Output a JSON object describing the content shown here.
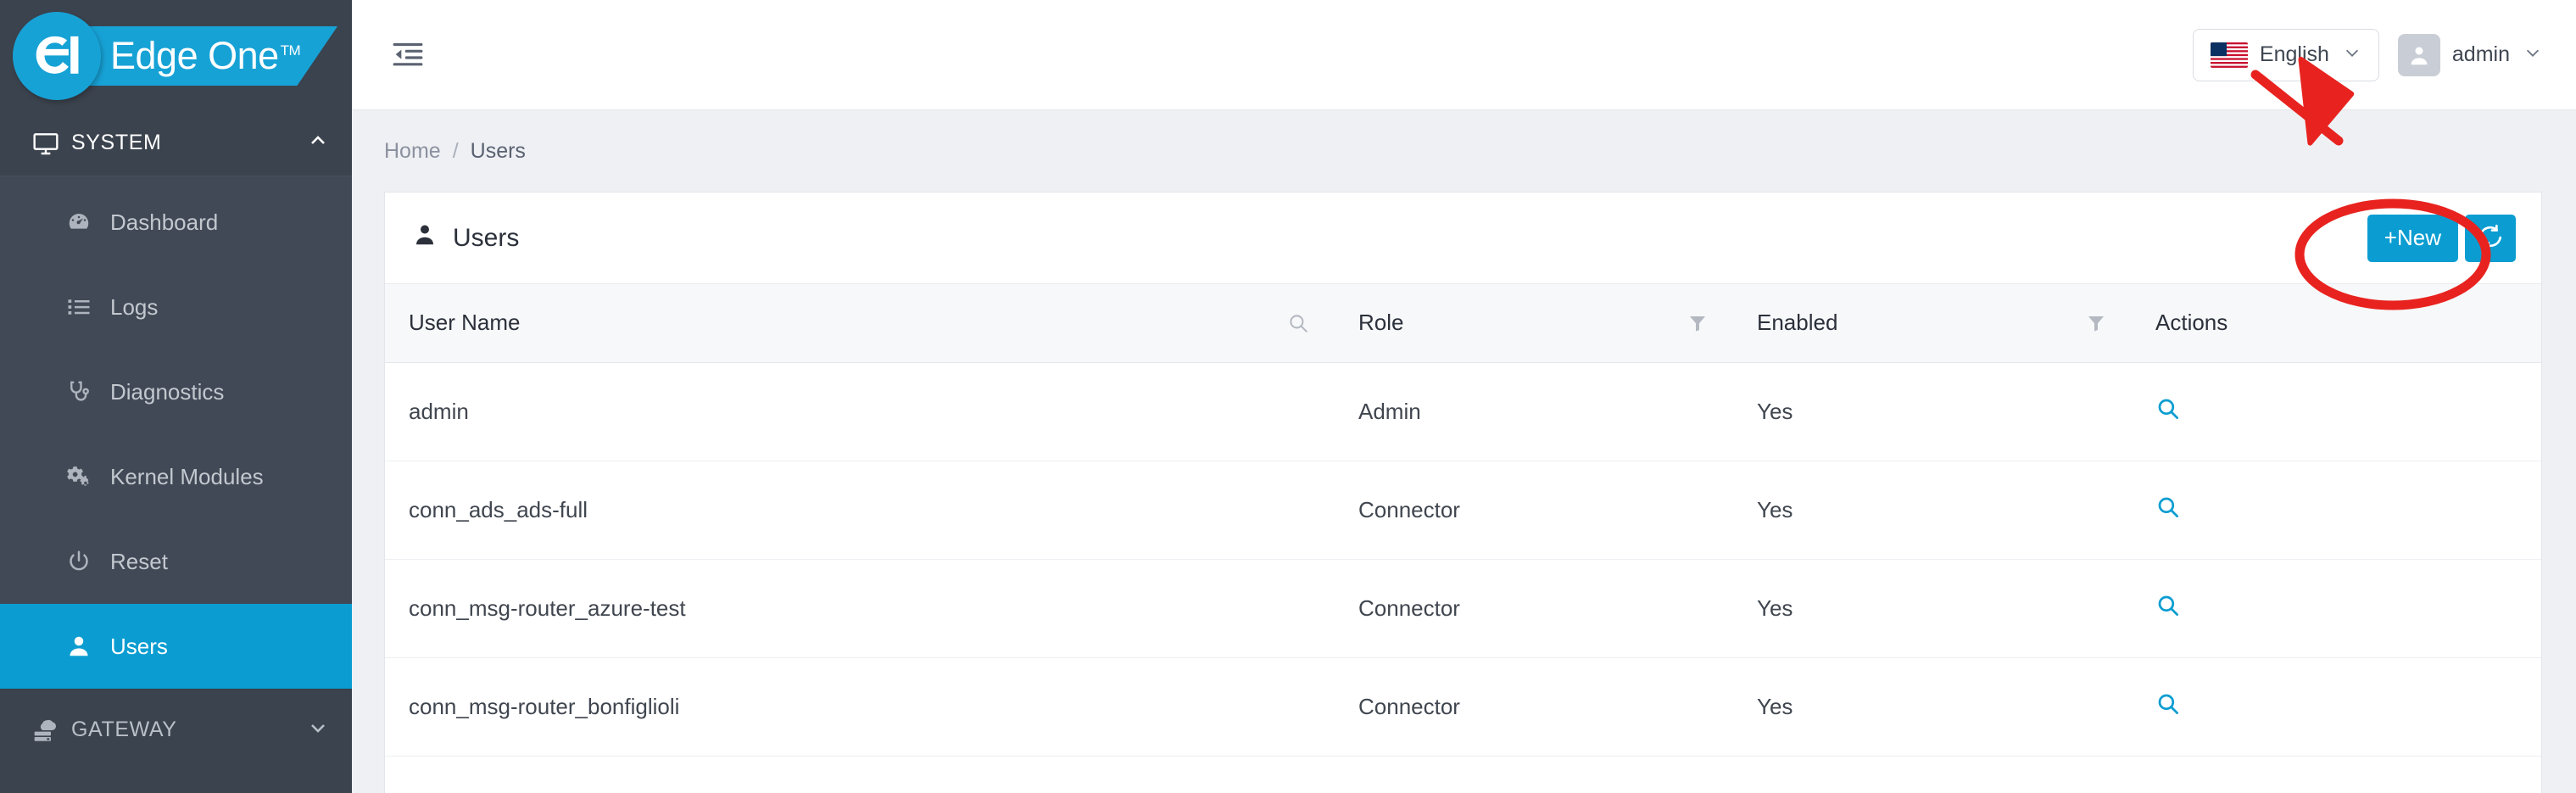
{
  "brand": {
    "name": "Edge One",
    "tm": "TM",
    "logo_icon": "edge-one-logo-icon"
  },
  "sidebar": {
    "groups": [
      {
        "label": "SYSTEM",
        "icon": "monitor-icon",
        "chevron": "chevron-up-icon",
        "expanded": true,
        "items": [
          {
            "label": "Dashboard",
            "icon": "dashboard-gauge-icon",
            "active": false
          },
          {
            "label": "Logs",
            "icon": "list-icon",
            "active": false
          },
          {
            "label": "Diagnostics",
            "icon": "stethoscope-icon",
            "active": false
          },
          {
            "label": "Kernel Modules",
            "icon": "gears-icon",
            "active": false
          },
          {
            "label": "Reset",
            "icon": "power-icon",
            "active": false
          },
          {
            "label": "Users",
            "icon": "user-icon",
            "active": true
          }
        ]
      },
      {
        "label": "GATEWAY",
        "icon": "server-cloud-icon",
        "chevron": "chevron-down-icon",
        "expanded": false,
        "items": []
      }
    ]
  },
  "topbar": {
    "collapse_icon": "collapse-sidebar-icon",
    "language": {
      "label": "English",
      "flag": "us-flag-icon",
      "chevron": "chevron-down-icon"
    },
    "user": {
      "label": "admin",
      "avatar_icon": "user-avatar-icon",
      "chevron": "chevron-down-icon"
    }
  },
  "breadcrumb": {
    "home": "Home",
    "separator": "/",
    "current": "Users"
  },
  "panel": {
    "title": "Users",
    "title_icon": "user-icon",
    "new_button": "+New",
    "refresh_icon": "refresh-icon"
  },
  "table": {
    "columns": [
      {
        "label": "User Name",
        "tool_icon": "search-icon"
      },
      {
        "label": "Role",
        "tool_icon": "filter-icon"
      },
      {
        "label": "Enabled",
        "tool_icon": "filter-icon"
      },
      {
        "label": "Actions",
        "tool_icon": ""
      }
    ],
    "rows": [
      {
        "user_name": "admin",
        "role": "Admin",
        "enabled": "Yes",
        "action_icon": "search-icon"
      },
      {
        "user_name": "conn_ads_ads-full",
        "role": "Connector",
        "enabled": "Yes",
        "action_icon": "search-icon"
      },
      {
        "user_name": "conn_msg-router_azure-test",
        "role": "Connector",
        "enabled": "Yes",
        "action_icon": "search-icon"
      },
      {
        "user_name": "conn_msg-router_bonfiglioli",
        "role": "Connector",
        "enabled": "Yes",
        "action_icon": "search-icon"
      }
    ]
  },
  "annotation": {
    "shape": "red-ellipse-highlight",
    "arrow": "red-arrow",
    "color": "#e8231f",
    "target": "+New"
  },
  "colors": {
    "sidebar_bg": "#3b434e",
    "sidebar_sub_bg": "#414956",
    "accent": "#0b9dd1",
    "brand_blue": "#17a2d6",
    "page_bg": "#eef0f4"
  }
}
